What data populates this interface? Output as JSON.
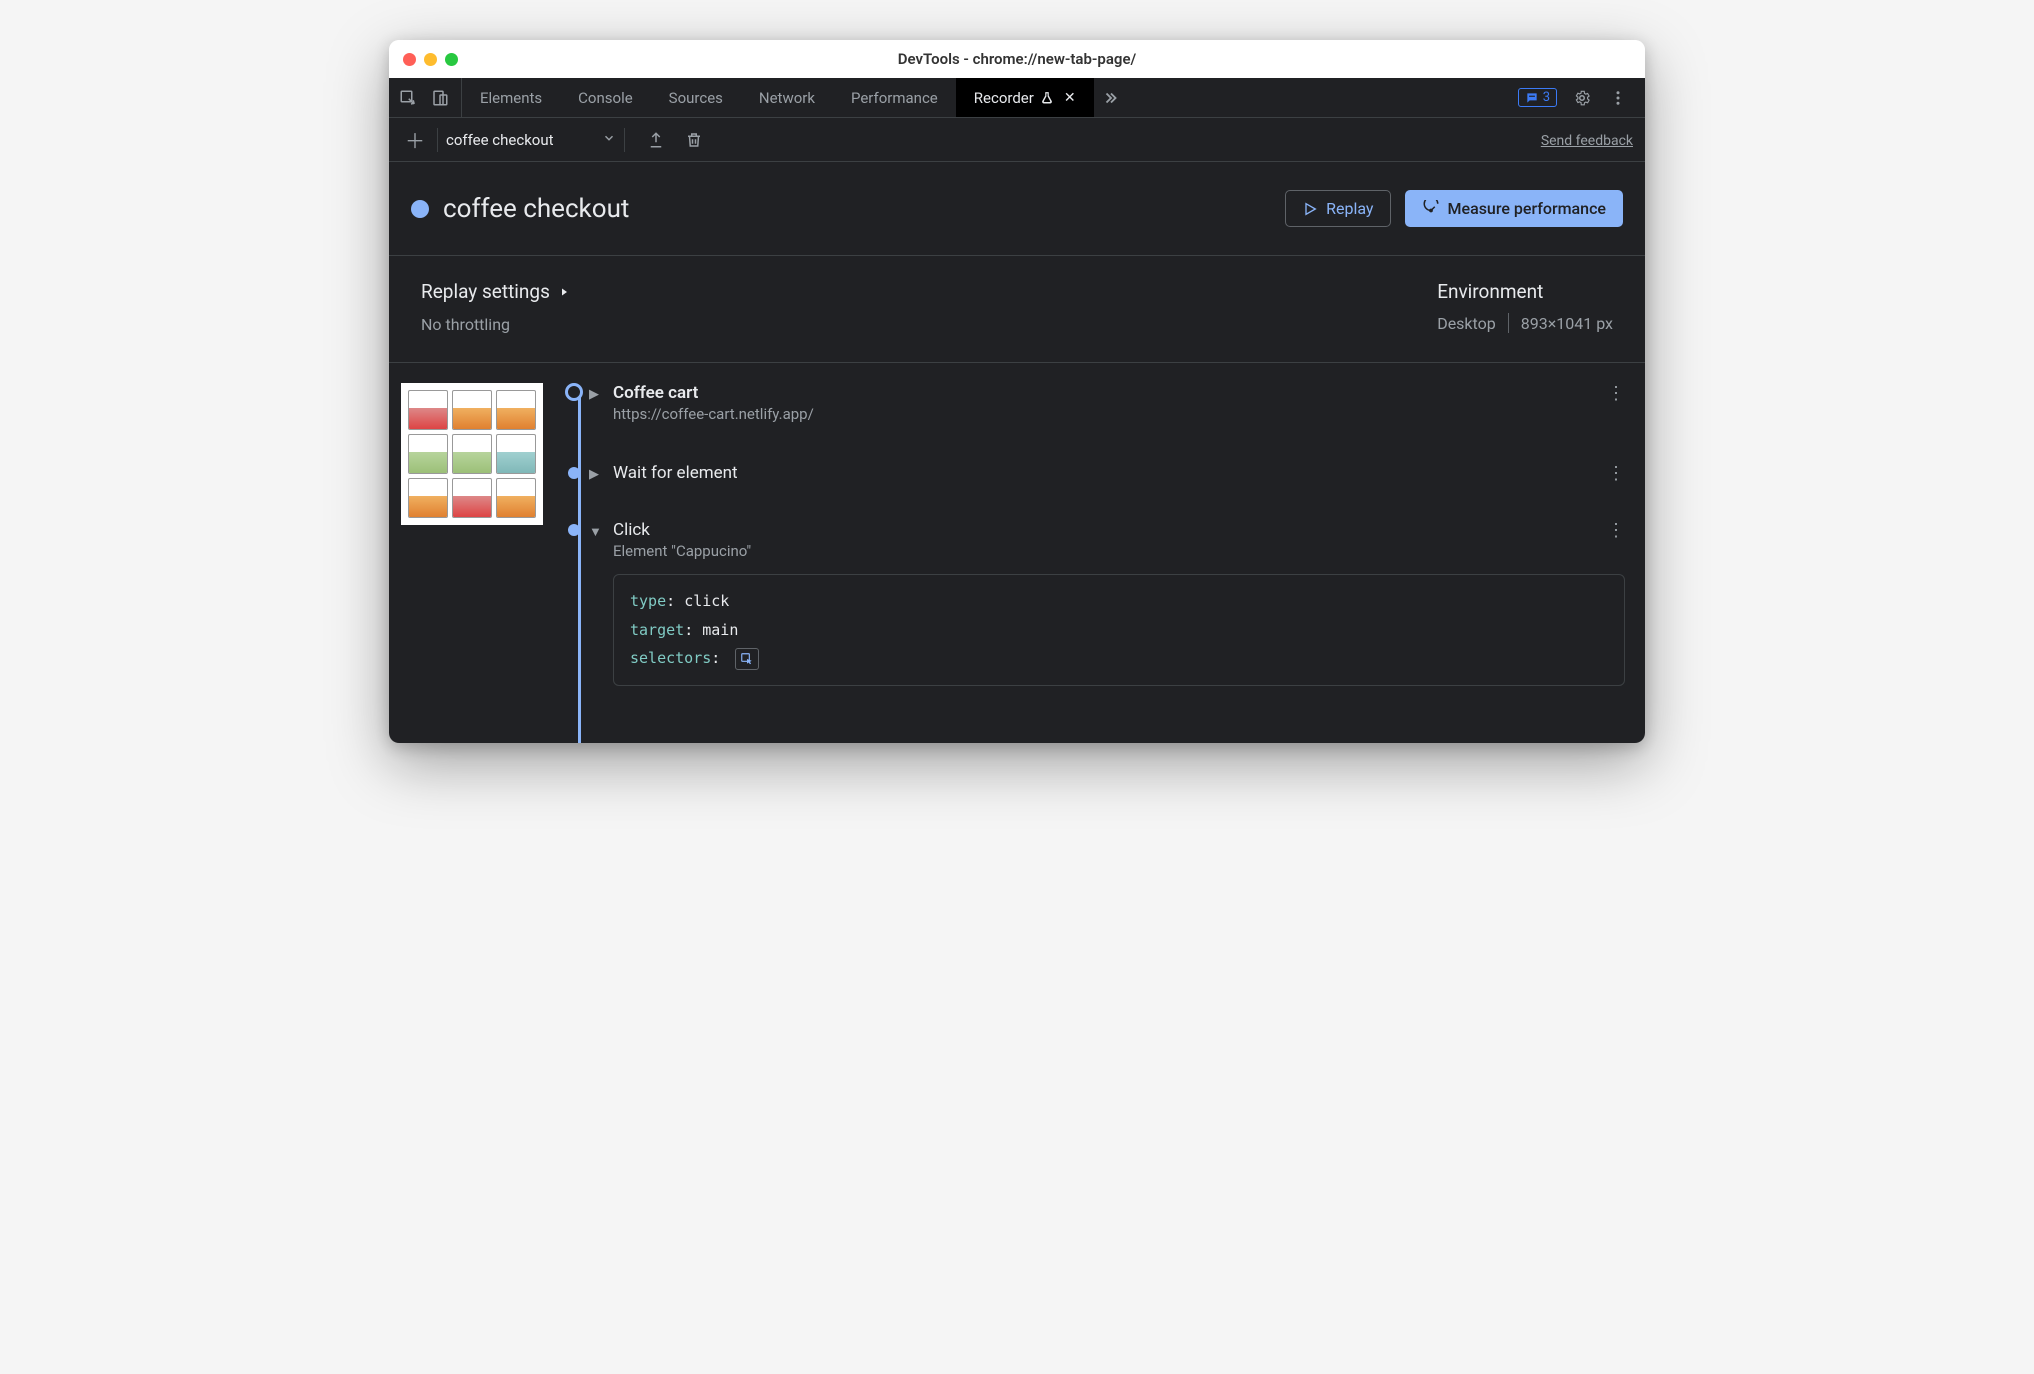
{
  "window": {
    "title": "DevTools - chrome://new-tab-page/"
  },
  "tabs": {
    "elements": "Elements",
    "console": "Console",
    "sources": "Sources",
    "network": "Network",
    "performance": "Performance",
    "recorder": "Recorder"
  },
  "issues_count": "3",
  "toolbar": {
    "recording_name": "coffee checkout",
    "send_feedback": "Send feedback"
  },
  "header": {
    "title": "coffee checkout",
    "replay_label": "Replay",
    "measure_label": "Measure performance"
  },
  "settings": {
    "replay_title": "Replay settings",
    "throttling": "No throttling",
    "env_title": "Environment",
    "device": "Desktop",
    "viewport": "893×1041 px"
  },
  "steps": {
    "s1": {
      "title": "Coffee cart",
      "url": "https://coffee-cart.netlify.app/"
    },
    "s2": {
      "title": "Wait for element"
    },
    "s3": {
      "title": "Click",
      "detail": "Element \"Cappucino\""
    },
    "code": {
      "type_k": "type",
      "type_v": "click",
      "target_k": "target",
      "target_v": "main",
      "selectors_k": "selectors"
    }
  }
}
